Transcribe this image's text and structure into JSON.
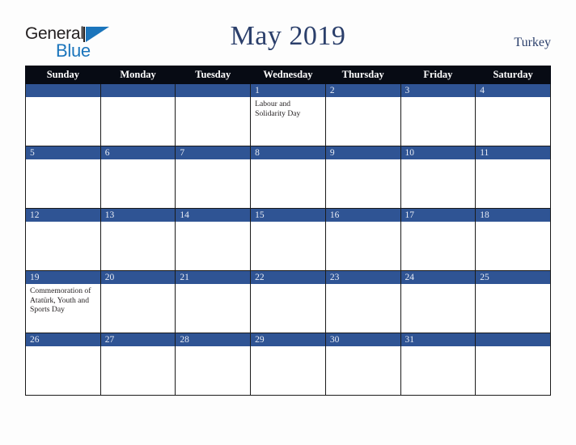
{
  "brand": {
    "word1": "General",
    "word2": "Blue",
    "mark_color": "#1b75bc"
  },
  "header": {
    "title": "May 2019",
    "region": "Turkey",
    "title_color": "#2b3f6b"
  },
  "calendar": {
    "weekday_headers": [
      "Sunday",
      "Monday",
      "Tuesday",
      "Wednesday",
      "Thursday",
      "Friday",
      "Saturday"
    ],
    "header_bg": "#070b14",
    "daynum_band_color": "#2f5494",
    "weeks": [
      [
        {
          "day": "",
          "events": []
        },
        {
          "day": "",
          "events": []
        },
        {
          "day": "",
          "events": []
        },
        {
          "day": "1",
          "events": [
            "Labour and Solidarity Day"
          ]
        },
        {
          "day": "2",
          "events": []
        },
        {
          "day": "3",
          "events": []
        },
        {
          "day": "4",
          "events": []
        }
      ],
      [
        {
          "day": "5",
          "events": []
        },
        {
          "day": "6",
          "events": []
        },
        {
          "day": "7",
          "events": []
        },
        {
          "day": "8",
          "events": []
        },
        {
          "day": "9",
          "events": []
        },
        {
          "day": "10",
          "events": []
        },
        {
          "day": "11",
          "events": []
        }
      ],
      [
        {
          "day": "12",
          "events": []
        },
        {
          "day": "13",
          "events": []
        },
        {
          "day": "14",
          "events": []
        },
        {
          "day": "15",
          "events": []
        },
        {
          "day": "16",
          "events": []
        },
        {
          "day": "17",
          "events": []
        },
        {
          "day": "18",
          "events": []
        }
      ],
      [
        {
          "day": "19",
          "events": [
            "Commemoration of Atatürk, Youth and Sports Day"
          ]
        },
        {
          "day": "20",
          "events": []
        },
        {
          "day": "21",
          "events": []
        },
        {
          "day": "22",
          "events": []
        },
        {
          "day": "23",
          "events": []
        },
        {
          "day": "24",
          "events": []
        },
        {
          "day": "25",
          "events": []
        }
      ],
      [
        {
          "day": "26",
          "events": []
        },
        {
          "day": "27",
          "events": []
        },
        {
          "day": "28",
          "events": []
        },
        {
          "day": "29",
          "events": []
        },
        {
          "day": "30",
          "events": []
        },
        {
          "day": "31",
          "events": []
        },
        {
          "day": "",
          "events": []
        }
      ]
    ]
  }
}
